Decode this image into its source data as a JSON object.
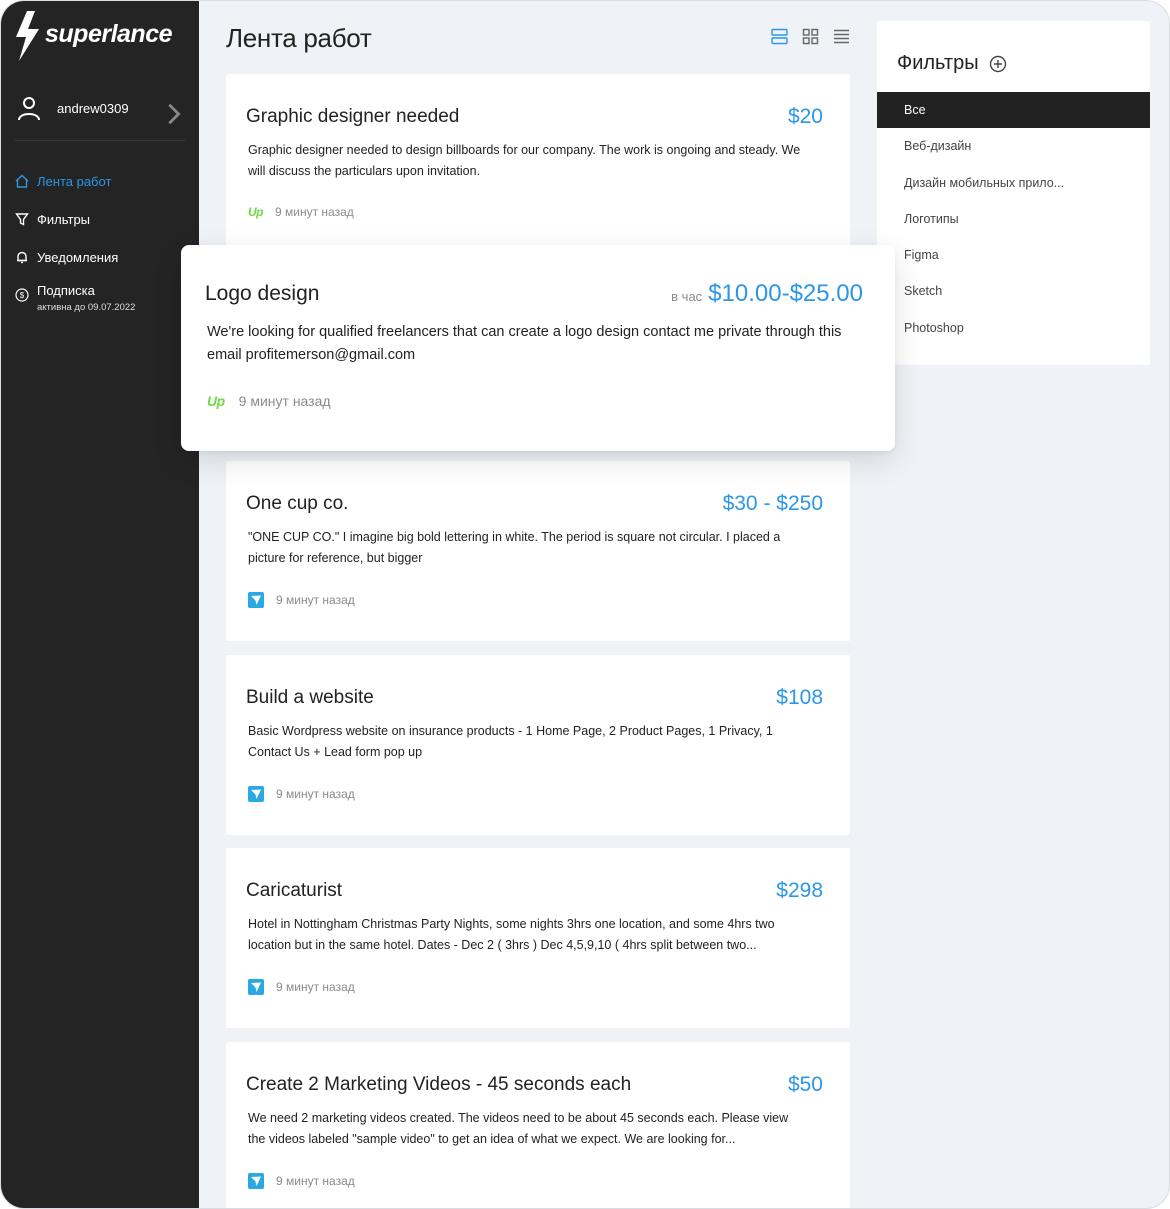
{
  "app": {
    "brand": "superlance",
    "user": "andrew0309"
  },
  "nav": [
    {
      "label": "Лента работ",
      "icon": "home-icon",
      "active": true
    },
    {
      "label": "Фильтры",
      "icon": "filter-icon",
      "active": false
    },
    {
      "label": "Уведомления",
      "icon": "bell-icon",
      "active": false
    },
    {
      "label": "Подписка",
      "sub": "активна до 09.07.2022",
      "icon": "dollar-icon",
      "active": false
    }
  ],
  "header": {
    "title": "Лента работ"
  },
  "jobs": [
    {
      "title": "Graphic designer needed",
      "price": "$20",
      "desc": "Graphic designer needed to design billboards for our company. The work is ongoing and steady. We will discuss the particulars upon invitation.",
      "time": "9 минут назад",
      "source": "Up"
    },
    {
      "title": "One cup co.",
      "price": "$30 - $250",
      "desc": "\"ONE CUP CO.\" I imagine big bold lettering in white. The period is square not circular. I placed a picture for reference, but bigger",
      "time": "9 минут назад",
      "source": "freelancer"
    },
    {
      "title": "Build a website",
      "price": "$108",
      "desc": "Basic Wordpress website on insurance products - 1 Home Page, 2 Product Pages, 1 Privacy, 1 Contact Us + Lead form pop up",
      "time": "9 минут назад",
      "source": "freelancer"
    },
    {
      "title": "Caricaturist",
      "price": "$298",
      "desc": "Hotel in Nottingham Christmas Party Nights, some nights 3hrs one location, and some 4hrs two location but in the same hotel. Dates - Dec 2 ( 3hrs ) Dec 4,5,9,10 ( 4hrs split between two...",
      "time": "9 минут назад",
      "source": "freelancer"
    },
    {
      "title": "Create 2 Marketing Videos - 45 seconds each",
      "price": "$50",
      "desc": "We need 2 marketing videos created. The videos need to be about 45 seconds each. Please view the videos labeled \"sample video\" to get an idea of what we expect. We are looking for...",
      "time": "9 минут назад",
      "source": "freelancer"
    }
  ],
  "featured": {
    "title": "Logo design",
    "rate": "в час",
    "price": "$10.00-$25.00",
    "desc": "We're looking for qualified freelancers that can create a logo design contact me private through this email profitemerson@gmail.com",
    "time": "9 минут назад",
    "source": "Up"
  },
  "filters": {
    "title": "Фильтры",
    "items": [
      "Все",
      "Веб-дизайн",
      "Дизайн мобильных прило...",
      "Логотипы",
      "Figma",
      "Sketch",
      "Photoshop"
    ]
  },
  "colors": {
    "accent": "#2b97e6",
    "sidebar": "#242424",
    "upwork": "#6fda44",
    "freelancer": "#29a8e2"
  }
}
